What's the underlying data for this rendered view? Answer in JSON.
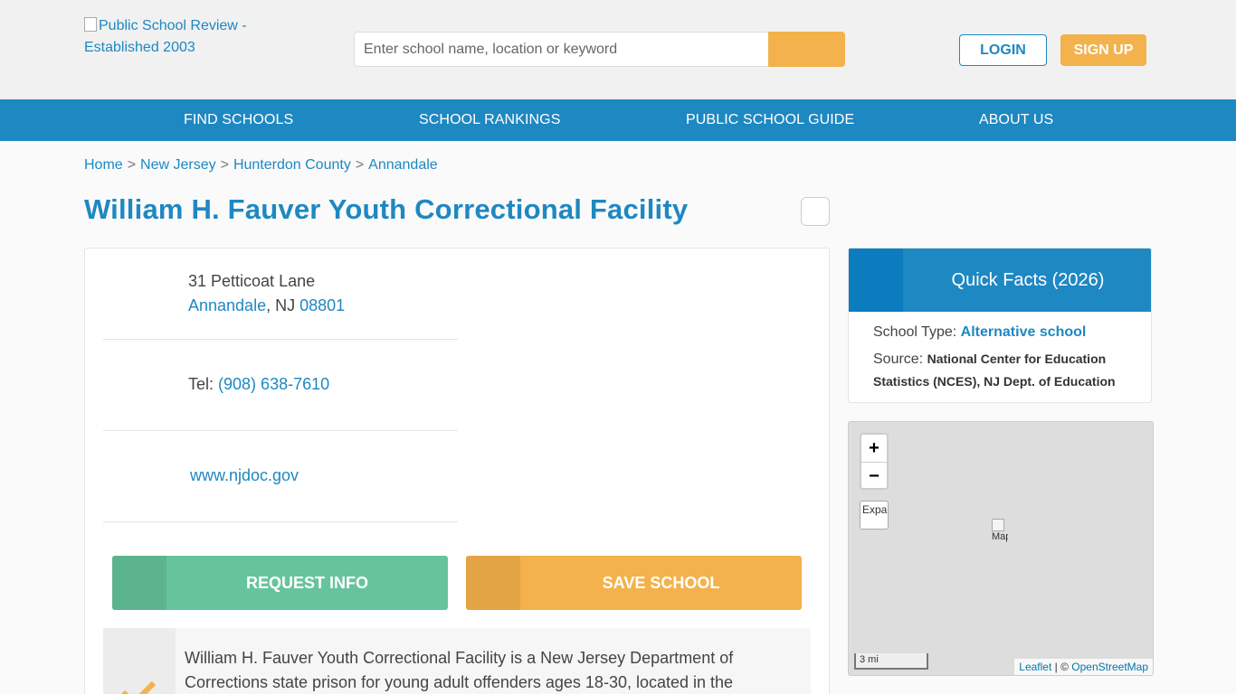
{
  "header": {
    "logo_alt": "Public School Review - Established 2003",
    "search_placeholder": "Enter school name, location or keyword",
    "login_label": "LOGIN",
    "signup_label": "SIGN UP"
  },
  "nav": {
    "items": [
      "FIND SCHOOLS",
      "SCHOOL RANKINGS",
      "PUBLIC SCHOOL GUIDE",
      "ABOUT US"
    ]
  },
  "breadcrumb": {
    "items": [
      "Home",
      "New Jersey",
      "Hunterdon County",
      "Annandale"
    ],
    "separator": ">"
  },
  "page_title": "William H. Fauver Youth Correctional Facility",
  "contact": {
    "street": "31 Petticoat Lane",
    "city": "Annandale",
    "state": "NJ",
    "zip": "08801",
    "tel_label": "Tel:",
    "phone": "(908) 638-7610",
    "website": "www.njdoc.gov"
  },
  "actions": {
    "request_label": "REQUEST INFO",
    "save_label": "SAVE SCHOOL"
  },
  "description": "William H. Fauver Youth Correctional Facility is a New Jersey Department of Corrections state prison for young adult offenders ages 18-30, located in the",
  "quick_facts": {
    "title": "Quick Facts (2026)",
    "school_type_label": "School Type:",
    "school_type_value": "Alternative school",
    "source_label": "Source:",
    "source_value": "National Center for Education Statistics (NCES), NJ Dept. of Education"
  },
  "map": {
    "zoom_in": "+",
    "zoom_out": "−",
    "expand_alt": "Expand",
    "marker_alt": "Map",
    "scale_label": "3 mi",
    "attribution_leaflet": "Leaflet",
    "attribution_sep": " | © ",
    "attribution_osm": "OpenStreetMap"
  },
  "colors": {
    "brand_blue": "#1e88c2",
    "accent_orange": "#f3b24b",
    "accent_green": "#66c49d"
  }
}
